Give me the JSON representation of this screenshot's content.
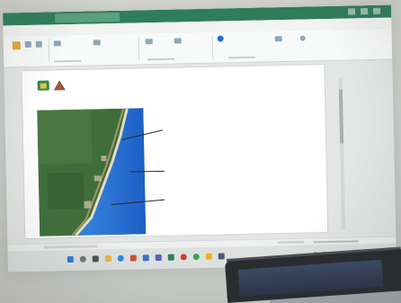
{
  "ribbon": {
    "tabs": [
      {
        "label": ""
      },
      {
        "label": "",
        "active": true
      },
      {
        "label": ""
      },
      {
        "label": ""
      },
      {
        "label": ""
      },
      {
        "label": ""
      },
      {
        "label": ""
      },
      {
        "label": ""
      },
      {
        "label": ""
      }
    ],
    "buttons": [
      {
        "label": ""
      },
      {
        "label": ""
      },
      {
        "label": ""
      },
      {
        "label": ""
      },
      {
        "label": ""
      },
      {
        "label": ""
      },
      {
        "label": ""
      },
      {
        "label": ""
      }
    ]
  },
  "slide": {
    "title": "",
    "callouts": [
      {
        "head": "",
        "lines": [
          "",
          ""
        ]
      },
      {
        "head": "",
        "lines": [
          "",
          ""
        ]
      },
      {
        "head": "",
        "lines": [
          "",
          ""
        ]
      }
    ]
  },
  "colors": {
    "title_bar": "#2f7d5a",
    "ocean": "#1e6fd6",
    "vegetation": "#3a6b3a",
    "slide_text": "#22305e"
  },
  "icons": {
    "logo_left": "municipal-coat-of-arms-icon",
    "logo_right": "institutional-emblem-icon",
    "taskbar": [
      "windows-start-icon",
      "search-icon",
      "task-view-icon",
      "file-explorer-icon",
      "browser-icon",
      "office-icon",
      "mail-icon",
      "chat-icon"
    ]
  }
}
